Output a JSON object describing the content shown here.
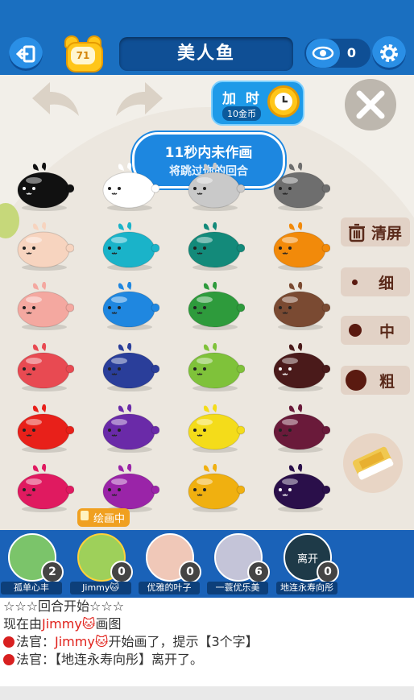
{
  "header": {
    "timer_value": "71",
    "word": "美人鱼",
    "viewer_count": "0"
  },
  "controls": {
    "add_time_label": "加 时",
    "add_time_cost": "10金币",
    "notice_line1": "11秒内未作画",
    "notice_line2": "将跳过你的回合"
  },
  "palette": {
    "colors": [
      [
        "#111111",
        "#ffffff",
        "#c9c9c9",
        "#6e6e6e"
      ],
      [
        "#f7d4bf",
        "#1ab3c9",
        "#138a7a",
        "#f28a0a"
      ],
      [
        "#f4a8a0",
        "#1f87e0",
        "#2e9b3c",
        "#7a4a32"
      ],
      [
        "#e84a52",
        "#2a3e9a",
        "#7fc23a",
        "#4a1a1a"
      ],
      [
        "#e8201a",
        "#6a2aa8",
        "#f4dc1a",
        "#6a1a3a"
      ],
      [
        "#e01a60",
        "#9a24a8",
        "#f0b010",
        "#2a0f4a"
      ]
    ]
  },
  "brush": {
    "clear_label": "清屏",
    "thin_label": "细",
    "medium_label": "中",
    "thick_label": "粗"
  },
  "drawing_tag": "绘画中",
  "players": [
    {
      "name": "孤单心丰",
      "score": "2",
      "avatar_color": "#7bc46a"
    },
    {
      "name": "Jimmy🐱",
      "score": "0",
      "avatar_color": "#9ed05a"
    },
    {
      "name": "优雅的叶子",
      "score": "0",
      "avatar_color": "#f0c8b8"
    },
    {
      "name": "一蓑优乐美",
      "score": "6",
      "avatar_color": "#c4c4d8"
    },
    {
      "name": "地连永寿向彤",
      "score": "0",
      "avatar_label": "离开",
      "avatar_color": "#1e3a48"
    }
  ],
  "chat": {
    "line1": "☆☆☆回合开始☆☆☆",
    "line2_prefix": "现在由",
    "line2_name": "Jimmy🐱",
    "line2_suffix": "画图",
    "line3_prefix": "法官：",
    "line3_name": "Jimmy🐱",
    "line3_suffix": "开始画了，提示【3个字】",
    "line4_prefix": "法官：",
    "line4_text": "【地连永寿向彤】离开了。"
  }
}
